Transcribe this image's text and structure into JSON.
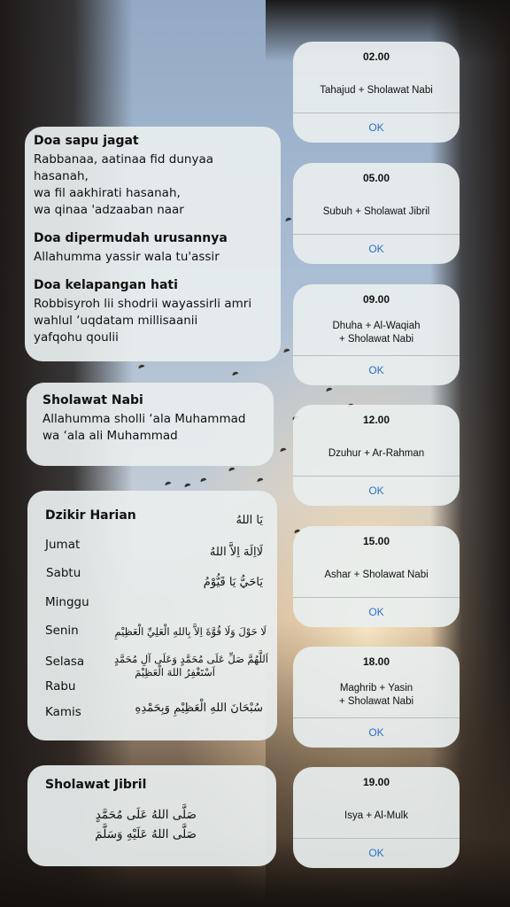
{
  "doa_card": {
    "sections": [
      {
        "title": "Doa sapu jagat",
        "body": "Rabbanaa, aatinaa fid dunyaa hasanah,\nwa fil aakhirati hasanah,\nwa qinaa 'adzaaban naar"
      },
      {
        "title": "Doa dipermudah urusannya",
        "body": "Allahumma yassir wala tu'assir"
      },
      {
        "title": "Doa kelapangan hati",
        "body": "Robbisyroh lii shodrii wayassirli amri\nwahlul ‘uqdatam millisaanii\nyafqohu qoulii"
      }
    ]
  },
  "sholawat_nabi": {
    "title": "Sholawat Nabi",
    "body": "Allahumma sholli ‘ala Muhammad\nwa ‘ala ali Muhammad"
  },
  "dzikir": {
    "title": "Dzikir Harian",
    "days": [
      "Jumat",
      "Sabtu",
      "Minggu",
      "Senin",
      "Selasa",
      "Rabu",
      "Kamis"
    ],
    "arabic": [
      "يَا اللهُ",
      "لَااِلَهَ اِلاَّ اللهُ",
      "يَاحَيُّ يَا قَيُّوْمُ",
      "لَا حَوْلَ وَلَا قُوَّةَ اِلاَّ بِاللهِ الْعَلِيِّ الْعَظِيْمِ",
      "اَللَّهُمَّ صَلِّ عَلَى مُحَمَّدٍ وَعَلَى آلِ مُحَمَّدٍ",
      "اَسْتَغْفِرُ اللهَ الْعَظِيْمَ",
      "سُبْحَانَ اللهِ الْعَظِيْمِ وَبِحَمْدِهِ"
    ]
  },
  "sholawat_jibril": {
    "title": "Sholawat Jibril",
    "line1": "صَلَّى اللهُ عَلَى مُحَمَّدٍ",
    "line2": "صَلَّى اللهُ عَلَيْهِ وَسَلَّمَ"
  },
  "alarms": [
    {
      "time": "02.00",
      "label": "Tahajud + Sholawat Nabi",
      "ok": "OK"
    },
    {
      "time": "05.00",
      "label": "Subuh + Sholawat Jibril",
      "ok": "OK"
    },
    {
      "time": "09.00",
      "label": "Dhuha + Al-Waqiah\n+ Sholawat Nabi",
      "ok": "OK"
    },
    {
      "time": "12.00",
      "label": "Dzuhur + Ar-Rahman",
      "ok": "OK"
    },
    {
      "time": "15.00",
      "label": "Ashar + Sholawat Nabi",
      "ok": "OK"
    },
    {
      "time": "18.00",
      "label": "Maghrib + Yasin\n+ Sholawat Nabi",
      "ok": "OK"
    },
    {
      "time": "19.00",
      "label": "Isya + Al-Mulk",
      "ok": "OK"
    }
  ],
  "colors": {
    "ok_link": "#2e6fc7",
    "card_bg": "#e8eeee"
  }
}
